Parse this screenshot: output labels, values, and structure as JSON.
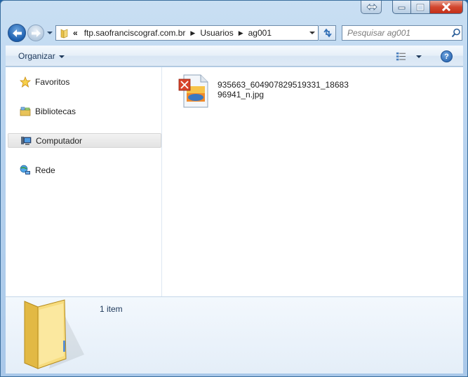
{
  "window": {
    "title_controls": [
      "minimize",
      "maximize",
      "close"
    ]
  },
  "address_bar": {
    "overflow_label": "«",
    "segments": [
      "ftp.saofranciscograf.com.br",
      "Usuarios",
      "ag001"
    ]
  },
  "search": {
    "placeholder": "Pesquisar ag001"
  },
  "command_bar": {
    "organize_label": "Organizar"
  },
  "nav_pane": {
    "items": [
      {
        "label": "Favoritos",
        "icon": "star-icon"
      },
      {
        "label": "Bibliotecas",
        "icon": "libraries-icon"
      },
      {
        "label": "Computador",
        "icon": "computer-icon",
        "selected": true
      },
      {
        "label": "Rede",
        "icon": "network-icon"
      }
    ]
  },
  "files": [
    {
      "name": "935663_604907829519331_1868396941_n.jpg",
      "icon": "jpg-file-icon"
    }
  ],
  "details_pane": {
    "item_count": "1 item"
  },
  "colors": {
    "accent": "#1e395b",
    "close_red": "#c3301a"
  }
}
